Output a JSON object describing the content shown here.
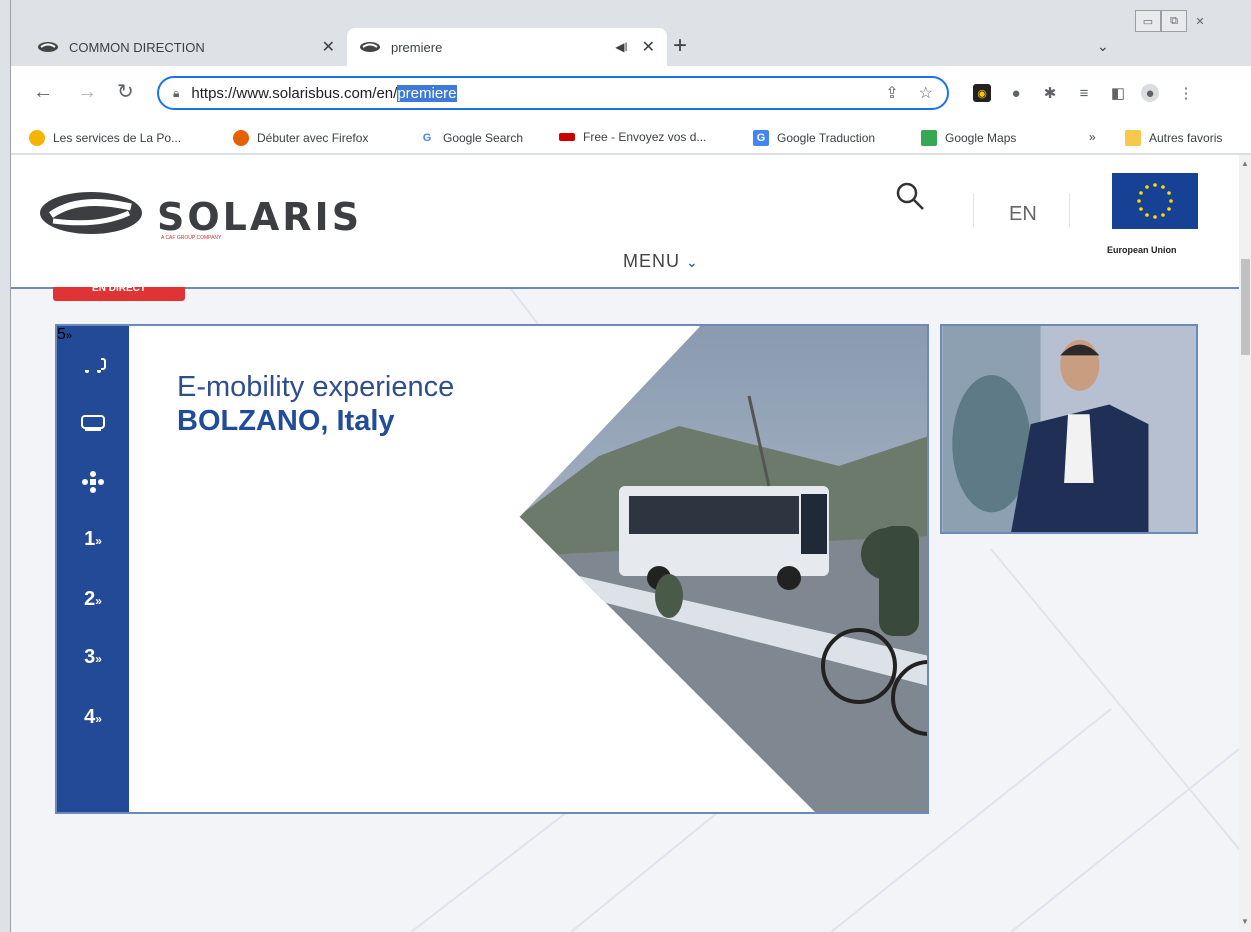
{
  "browser": {
    "tabs": [
      {
        "title": "COMMON DIRECTION",
        "active": false
      },
      {
        "title": "premiere",
        "active": true,
        "audio": true
      }
    ],
    "new_tab": "+",
    "tab_search": "⌄",
    "address": {
      "prefix": "https://www.solarisbus.com/en/",
      "selected": "premiere"
    },
    "bookmarks": [
      {
        "label": "Les services de La Po...",
        "color": "#f4b400"
      },
      {
        "label": "Débuter avec Firefox",
        "color": "#e66000"
      },
      {
        "label": "Google Search",
        "color": "#4285f4"
      },
      {
        "label": "Free - Envoyez vos d...",
        "color": "#cc0000"
      },
      {
        "label": "Google Traduction",
        "color": "#4285f4"
      },
      {
        "label": "Google Maps",
        "color": "#34a853"
      }
    ],
    "bookmarks_overflow": "»",
    "other_bookmarks": "Autres favoris"
  },
  "site": {
    "logo_text": "SOLARIS",
    "logo_sub": "A CAF GROUP COMPANY",
    "lang": "EN",
    "eu_label": "European Union",
    "menu_label": "MENU",
    "live_badge": "EN DIRECT",
    "slide": {
      "line1": "E-mobility experience",
      "line2": "BOLZANO, Italy",
      "rail_items": [
        "1",
        "2",
        "3",
        "4"
      ],
      "rail_final": "5"
    }
  },
  "colors": {
    "brand_blue": "#234a96",
    "live_red": "#e03434",
    "focus_blue": "#1a73e8"
  }
}
